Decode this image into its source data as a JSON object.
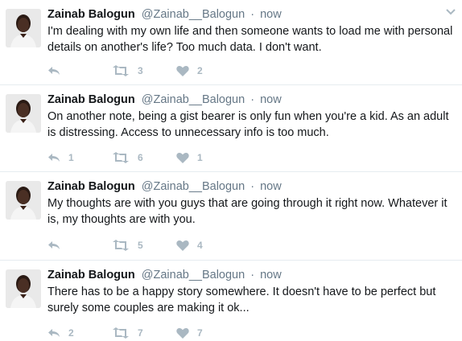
{
  "tweets": [
    {
      "name": "Zainab Balogun",
      "handle": "@Zainab__Balogun",
      "separator": "·",
      "time": "now",
      "text": "I'm dealing with my own life and then someone wants to load me with personal details on another's life? Too much data. I don't want.",
      "replies": "",
      "retweets": "3",
      "likes": "2"
    },
    {
      "name": "Zainab Balogun",
      "handle": "@Zainab__Balogun",
      "separator": "·",
      "time": "now",
      "text": "On another note, being a gist bearer is only fun when you're a kid. As an adult is distressing. Access to unnecessary info is too much.",
      "replies": "1",
      "retweets": "6",
      "likes": "1"
    },
    {
      "name": "Zainab Balogun",
      "handle": "@Zainab__Balogun",
      "separator": "·",
      "time": "now",
      "text": "My thoughts are with you guys that are going through it right now. Whatever it is, my thoughts are with you.",
      "replies": "",
      "retweets": "5",
      "likes": "4"
    },
    {
      "name": "Zainab Balogun",
      "handle": "@Zainab__Balogun",
      "separator": "·",
      "time": "now",
      "text": "There has to be a happy story somewhere. It doesn't have to be perfect but surely some couples are making it ok...",
      "replies": "2",
      "retweets": "7",
      "likes": "7"
    }
  ],
  "icons": {
    "reply": "reply-icon",
    "retweet": "retweet-icon",
    "like": "heart-icon",
    "menu": "chevron-down-icon"
  },
  "colors": {
    "text": "#14171a",
    "secondary": "#657786",
    "action_icon": "#aab8c2",
    "divider": "#e6ecf0"
  }
}
